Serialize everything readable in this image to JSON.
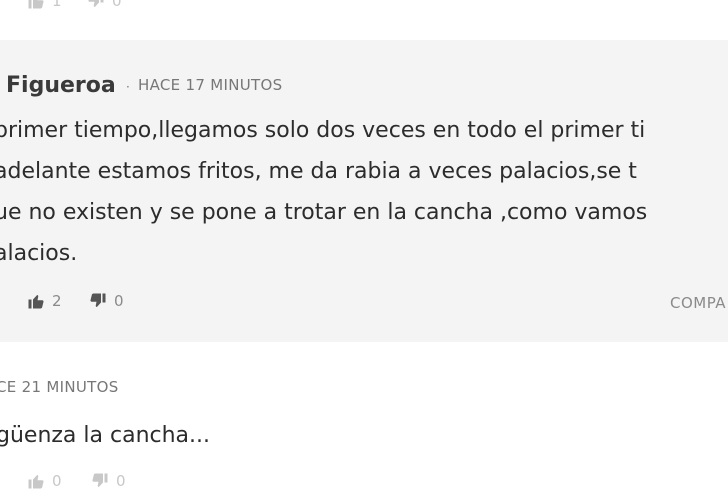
{
  "top_comment": {
    "likes": "1",
    "dislikes": "0"
  },
  "main_comment": {
    "author": "Figueroa",
    "separator": "·",
    "time": "HACE 17 MINUTOS",
    "lines": [
      "primer tiempo,llegamos solo dos veces en todo el primer ti",
      "adelante estamos fritos, me da rabia a veces palacios,se t",
      "ue no existen y se pone a trotar en la cancha ,como vamos",
      "alacios."
    ],
    "likes": "2",
    "dislikes": "0",
    "share_label": "COMPA"
  },
  "next_comment": {
    "time": "CE 21 MINUTOS",
    "text": "güenza la cancha...",
    "likes": "0",
    "dislikes": "0"
  },
  "icons": {
    "like": "thumbs-up-icon",
    "dislike": "thumbs-down-icon"
  },
  "colors": {
    "comment_bg": "#f4f4f4",
    "text": "#2c2c2c",
    "muted": "#8a8a8a"
  }
}
